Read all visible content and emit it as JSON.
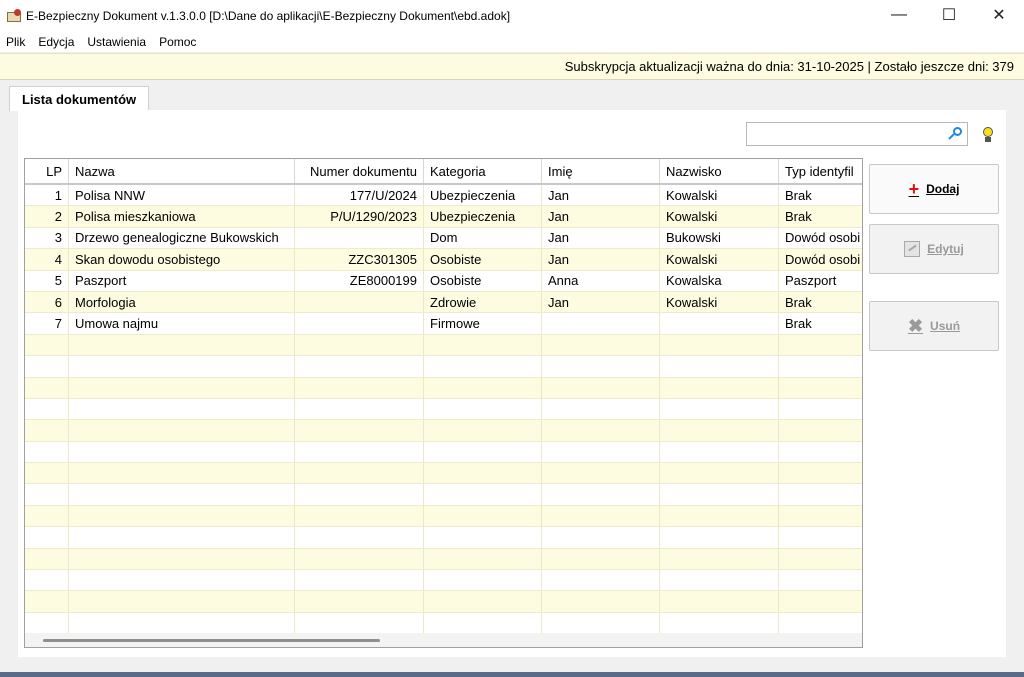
{
  "window": {
    "title": "E-Bezpieczny Dokument v.1.3.0.0 [D:\\Dane do aplikacji\\E-Bezpieczny Dokument\\ebd.adok]",
    "minimize": "—",
    "maximize": "☐",
    "close": "✕"
  },
  "menu": [
    "Plik",
    "Edycja",
    "Ustawienia",
    "Pomoc"
  ],
  "subscription": "Subskrypcja aktualizacji ważna do dnia: 31-10-2025 | Zostało jeszcze dni: 379",
  "tab": "Lista dokumentów",
  "search": {
    "value": ""
  },
  "grid": {
    "columns": [
      "LP",
      "Nazwa",
      "Numer dokumentu",
      "Kategoria",
      "Imię",
      "Nazwisko",
      "Typ identyfil"
    ],
    "rows": [
      [
        "1",
        "Polisa NNW",
        "177/U/2024",
        "Ubezpieczenia",
        "Jan",
        "Kowalski",
        "Brak"
      ],
      [
        "2",
        "Polisa mieszkaniowa",
        "P/U/1290/2023",
        "Ubezpieczenia",
        "Jan",
        "Kowalski",
        "Brak"
      ],
      [
        "3",
        "Drzewo genealogiczne Bukowskich",
        "",
        "Dom",
        "Jan",
        "Bukowski",
        "Dowód osobi"
      ],
      [
        "4",
        "Skan dowodu osobistego",
        "ZZC301305",
        "Osobiste",
        "Jan",
        "Kowalski",
        "Dowód osobi"
      ],
      [
        "5",
        "Paszport",
        "ZE8000199",
        "Osobiste",
        "Anna",
        "Kowalska",
        "Paszport"
      ],
      [
        "6",
        "Morfologia",
        "",
        "Zdrowie",
        "Jan",
        "Kowalski",
        "Brak"
      ],
      [
        "7",
        "Umowa najmu",
        "",
        "Firmowe",
        "",
        "",
        "Brak"
      ]
    ],
    "empty_rows": 14
  },
  "buttons": {
    "add": "Dodaj",
    "edit": "Edytuj",
    "delete": "Usuń"
  },
  "colors": {
    "row_alt": "#fdfbe0",
    "add_icon": "#dd1111",
    "search_icon": "#1e88e5"
  }
}
